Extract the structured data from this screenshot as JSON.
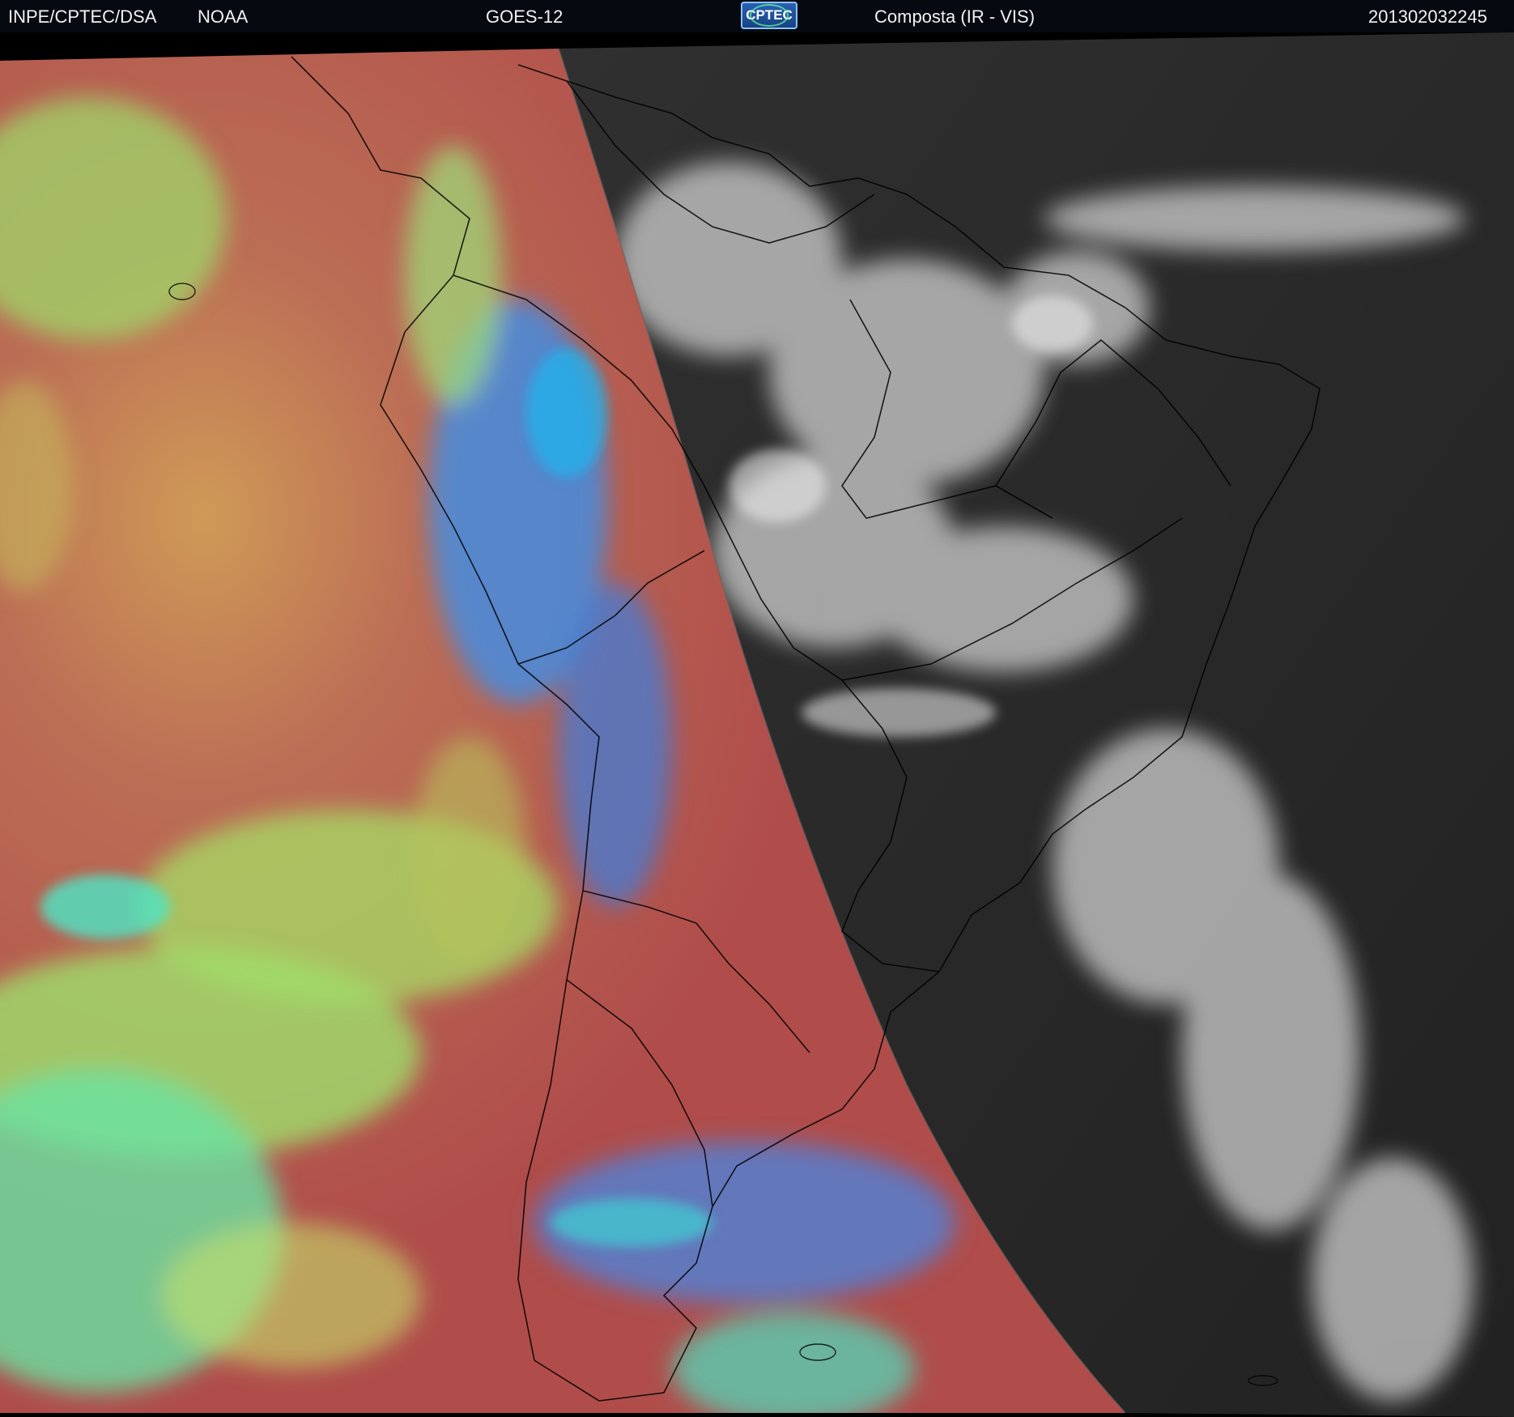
{
  "header": {
    "institution": "INPE/CPTEC/DSA",
    "agency": "NOAA",
    "satellite": "GOES-12",
    "logo_text": "CPTEC",
    "product": "Composta (IR - VIS)",
    "timestamp": "201302032245"
  },
  "icons": {
    "logo": "cptec-logo-icon"
  },
  "colors": {
    "header_bg": "#050a10",
    "ir_warm": "#b9524d",
    "ir_cloud_low": "#a9df6a",
    "ir_cloud_high": "#2e8df0",
    "vis_background": "#2b2b2b",
    "vis_cloud": "#d8d8d8",
    "borders": "#000000"
  }
}
